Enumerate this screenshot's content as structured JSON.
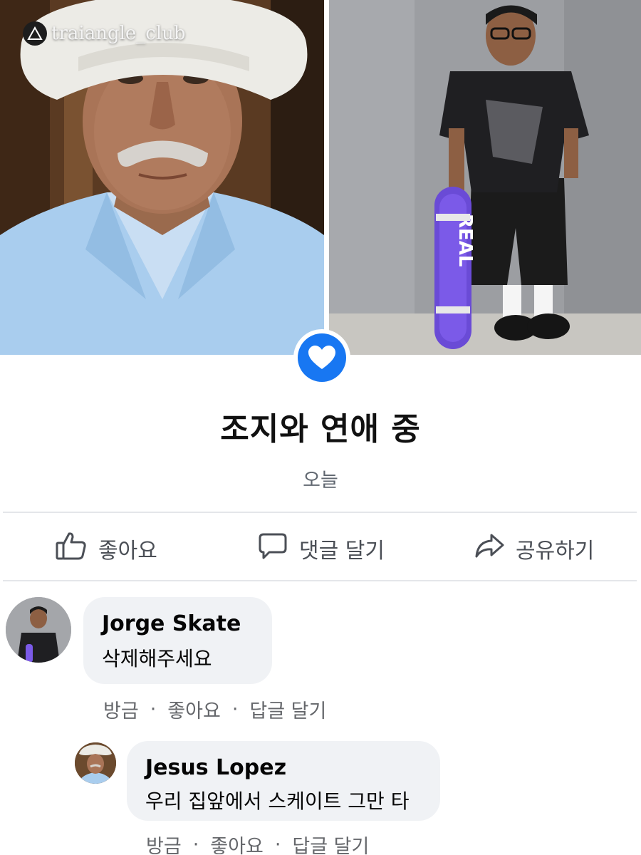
{
  "watermark": {
    "text": "traiangle_club"
  },
  "status": {
    "title": "조지와 연애 중",
    "time": "오늘"
  },
  "actions": [
    {
      "label": "좋아요",
      "icon": "thumbs-up-icon"
    },
    {
      "label": "댓글 달기",
      "icon": "comment-icon"
    },
    {
      "label": "공유하기",
      "icon": "share-icon"
    }
  ],
  "comments": [
    {
      "author": "Jorge Skate",
      "text": "삭제해주세요",
      "time": "방금",
      "like_label": "좋아요",
      "reply_label": "답글 달기"
    },
    {
      "author": "Jesus Lopez",
      "text": "우리 집앞에서 스케이트 그만 타",
      "time": "방금",
      "like_label": "좋아요",
      "reply_label": "답글 달기"
    }
  ],
  "colors": {
    "accent": "#1877f2",
    "bubble": "#f0f2f5",
    "meta": "#65676b"
  }
}
